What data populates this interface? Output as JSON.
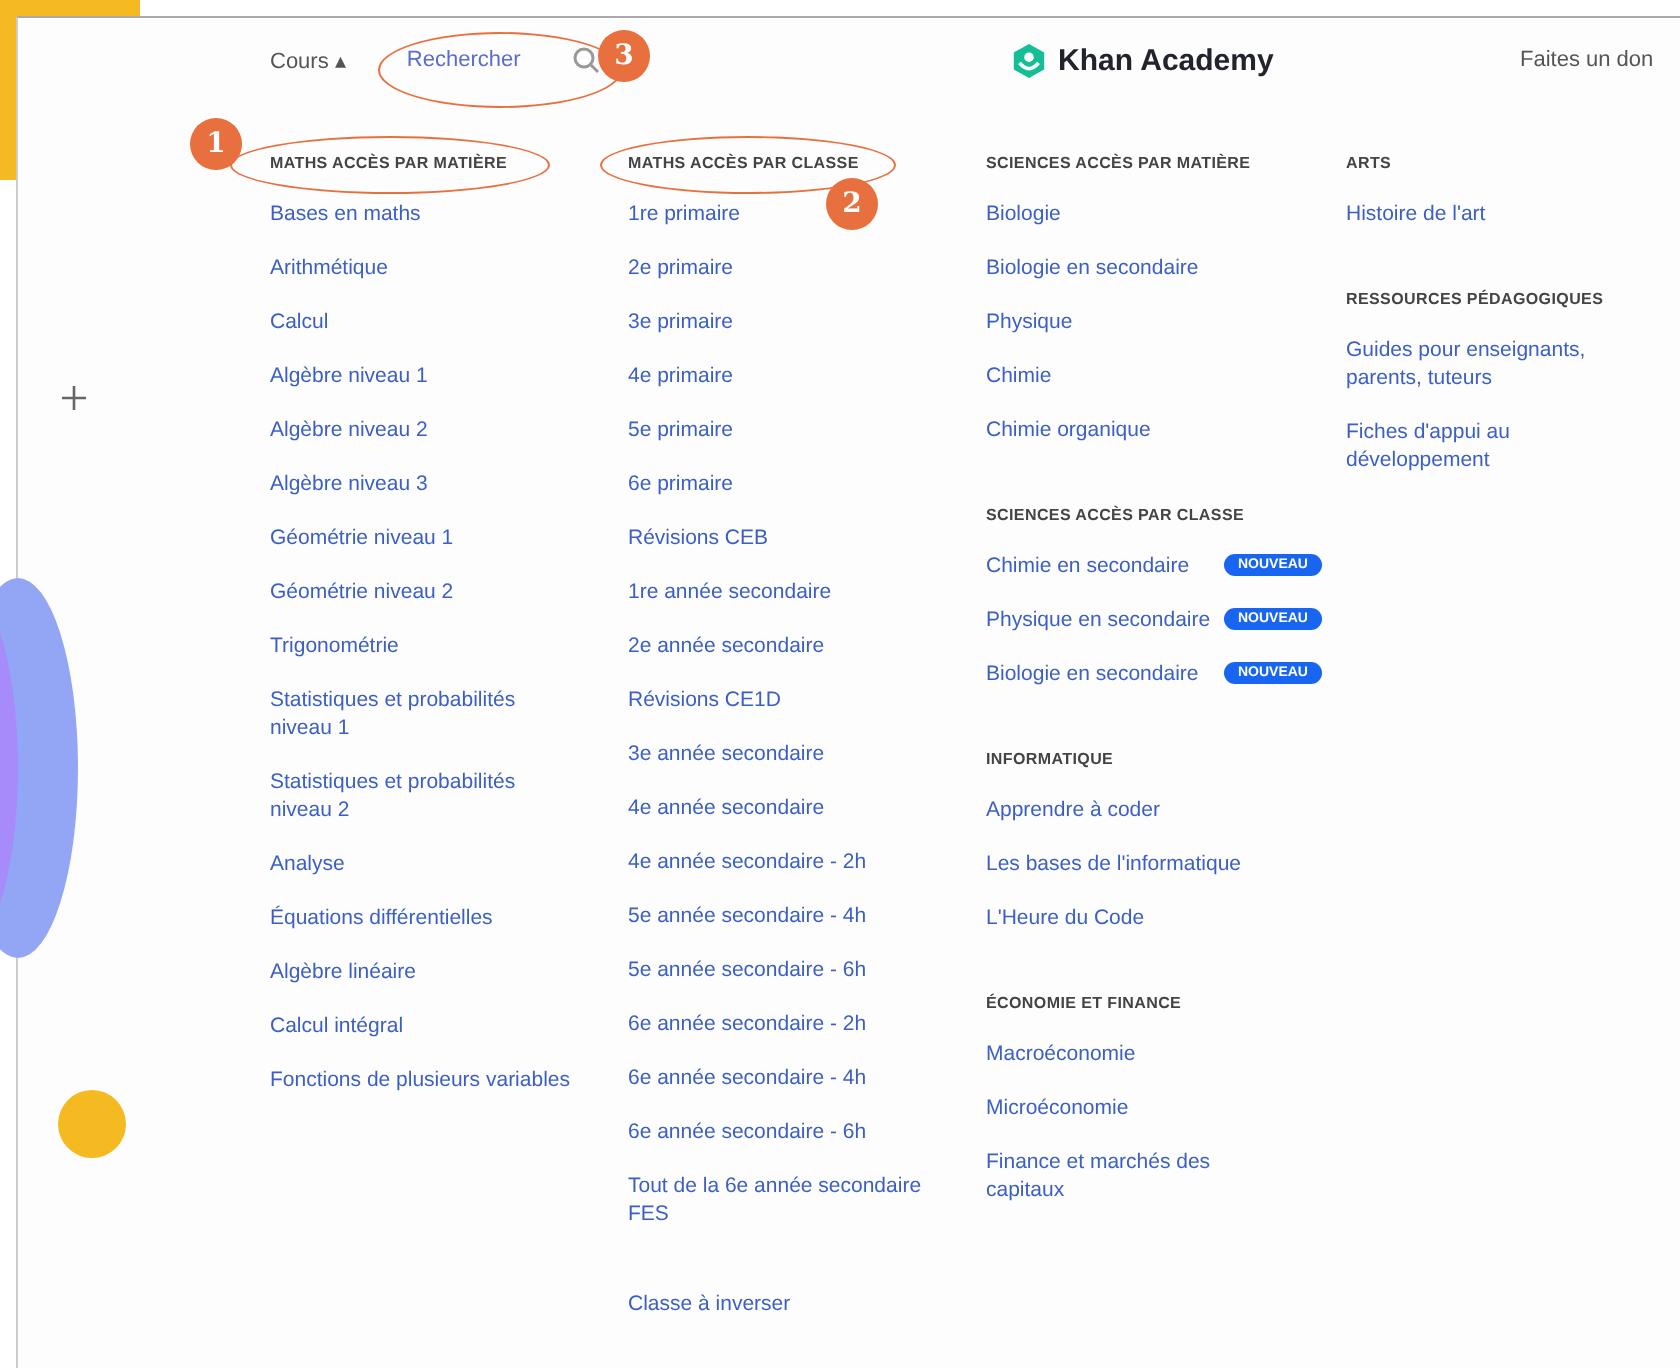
{
  "header": {
    "courses": "Cours ▴",
    "search": "Rechercher",
    "logo": "Khan Academy",
    "donate": "Faites un don"
  },
  "columns": [
    {
      "sections": [
        {
          "heading": "MATHS ACCÈS PAR MATIÈRE",
          "items": [
            {
              "label": "Bases en maths"
            },
            {
              "label": "Arithmétique"
            },
            {
              "label": "Calcul"
            },
            {
              "label": "Algèbre niveau 1"
            },
            {
              "label": "Algèbre niveau 2"
            },
            {
              "label": "Algèbre niveau 3"
            },
            {
              "label": "Géométrie niveau 1"
            },
            {
              "label": "Géométrie niveau 2"
            },
            {
              "label": "Trigonométrie"
            },
            {
              "label": "Statistiques et probabilités niveau 1"
            },
            {
              "label": "Statistiques et probabilités niveau 2"
            },
            {
              "label": "Analyse"
            },
            {
              "label": "Équations différentielles"
            },
            {
              "label": "Algèbre linéaire"
            },
            {
              "label": "Calcul intégral"
            },
            {
              "label": "Fonctions de plusieurs variables"
            }
          ]
        }
      ]
    },
    {
      "sections": [
        {
          "heading": "MATHS ACCÈS PAR CLASSE",
          "items": [
            {
              "label": "1re primaire"
            },
            {
              "label": "2e primaire"
            },
            {
              "label": "3e primaire"
            },
            {
              "label": "4e primaire"
            },
            {
              "label": "5e primaire"
            },
            {
              "label": "6e primaire"
            },
            {
              "label": "Révisions CEB"
            },
            {
              "label": "1re année secondaire"
            },
            {
              "label": "2e année secondaire"
            },
            {
              "label": "Révisions CE1D"
            },
            {
              "label": "3e année secondaire"
            },
            {
              "label": "4e année secondaire"
            },
            {
              "label": "4e année secondaire - 2h"
            },
            {
              "label": "5e année secondaire - 4h"
            },
            {
              "label": "5e année secondaire - 6h"
            },
            {
              "label": "6e année secondaire - 2h"
            },
            {
              "label": "6e année secondaire - 4h"
            },
            {
              "label": "6e année secondaire - 6h"
            },
            {
              "label": "Tout de la 6e année secondaire FES"
            }
          ]
        },
        {
          "items": [
            {
              "label": "Classe à inverser"
            }
          ]
        }
      ]
    },
    {
      "sections": [
        {
          "heading": "SCIENCES ACCÈS PAR MATIÈRE",
          "items": [
            {
              "label": "Biologie"
            },
            {
              "label": "Biologie en secondaire"
            },
            {
              "label": "Physique"
            },
            {
              "label": "Chimie"
            },
            {
              "label": "Chimie organique"
            }
          ]
        },
        {
          "heading": "SCIENCES ACCÈS PAR CLASSE",
          "items": [
            {
              "label": "Chimie en secondaire",
              "badge": "NOUVEAU"
            },
            {
              "label": "Physique en secondaire",
              "badge": "NOUVEAU"
            },
            {
              "label": "Biologie en secondaire",
              "badge": "NOUVEAU"
            }
          ]
        },
        {
          "heading": "INFORMATIQUE",
          "items": [
            {
              "label": "Apprendre à coder"
            },
            {
              "label": "Les bases de l'informatique"
            },
            {
              "label": "L'Heure du Code"
            }
          ]
        },
        {
          "heading": "ÉCONOMIE ET FINANCE",
          "items": [
            {
              "label": "Macroéconomie"
            },
            {
              "label": "Microéconomie"
            },
            {
              "label": "Finance et marchés des capitaux"
            }
          ]
        }
      ]
    },
    {
      "sections": [
        {
          "heading": "ARTS",
          "items": [
            {
              "label": "Histoire de l'art"
            }
          ]
        },
        {
          "heading": "RESSOURCES PÉDAGOGIQUES",
          "items": [
            {
              "label": "Guides pour enseignants, parents, tuteurs"
            },
            {
              "label": "Fiches d'appui au développement"
            }
          ]
        }
      ]
    }
  ],
  "annotations": [
    {
      "number": "1"
    },
    {
      "number": "2"
    },
    {
      "number": "3"
    }
  ]
}
